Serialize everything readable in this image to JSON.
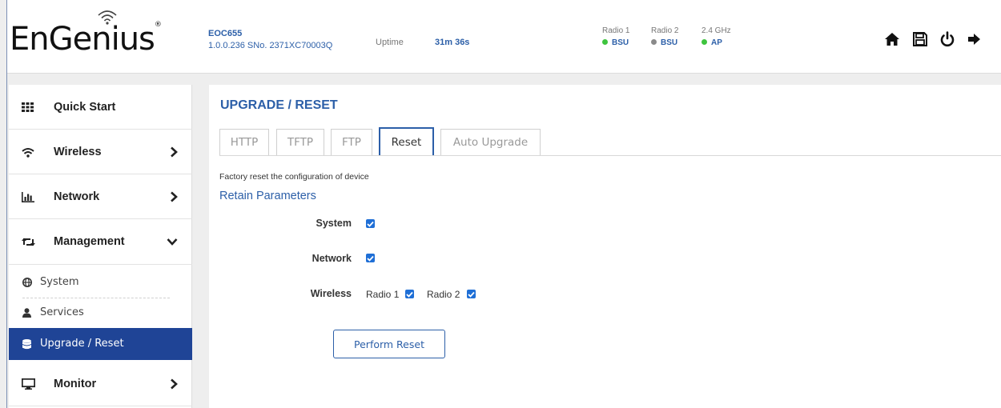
{
  "brand": {
    "logo_text": "EnGenius",
    "logo_mark": "®"
  },
  "device": {
    "model": "EOC655",
    "firmware_serial": "1.0.0.236 SNo. 2371XC70003Q",
    "uptime_label": "Uptime",
    "uptime_value": "31m 36s"
  },
  "radios": [
    {
      "label": "Radio 1",
      "status": "BSU",
      "color": "#3ec43e"
    },
    {
      "label": "Radio 2",
      "status": "BSU",
      "color": "#8a8a8a"
    },
    {
      "label": "2.4 GHz",
      "status": "AP",
      "color": "#3ec43e"
    }
  ],
  "header_icons": [
    "home-icon",
    "save-icon",
    "power-icon",
    "logout-icon"
  ],
  "sidebar": {
    "items": [
      {
        "label": "Quick Start",
        "icon": "grid-icon"
      },
      {
        "label": "Wireless",
        "icon": "wifi-icon",
        "chevron": "right"
      },
      {
        "label": "Network",
        "icon": "bar-chart-icon",
        "chevron": "right"
      },
      {
        "label": "Management",
        "icon": "retweet-icon",
        "chevron": "down"
      },
      {
        "label": "Monitor",
        "icon": "monitor-icon",
        "chevron": "right"
      }
    ],
    "sub_items": [
      {
        "label": "System",
        "icon": "globe-icon"
      },
      {
        "label": "Services",
        "icon": "user-icon"
      },
      {
        "label": "Upgrade / Reset",
        "icon": "database-icon",
        "active": true
      }
    ]
  },
  "main": {
    "title": "UPGRADE / RESET",
    "tabs": [
      {
        "label": "HTTP"
      },
      {
        "label": "TFTP"
      },
      {
        "label": "FTP"
      },
      {
        "label": "Reset",
        "active": true
      },
      {
        "label": "Auto Upgrade"
      }
    ],
    "description": "Factory reset the configuration of device",
    "section_title": "Retain Parameters",
    "params": {
      "system_label": "System",
      "system_checked": true,
      "network_label": "Network",
      "network_checked": true,
      "wireless_label": "Wireless",
      "radio1_label": "Radio 1",
      "radio1_checked": true,
      "radio2_label": "Radio 2",
      "radio2_checked": true
    },
    "reset_button": "Perform Reset"
  },
  "colors": {
    "accent": "#2c5fa8",
    "active_nav": "#1f4496",
    "checkbox": "#1f6fd6"
  }
}
